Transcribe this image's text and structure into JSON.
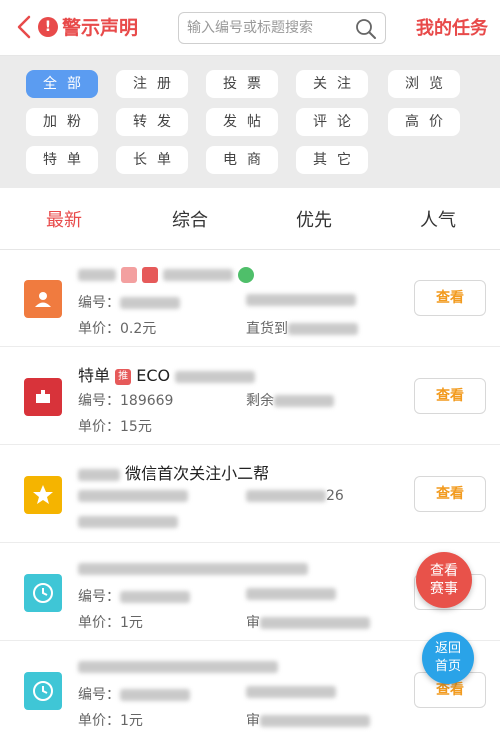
{
  "header": {
    "title": "警示声明",
    "search_placeholder": "输入编号或标题搜索",
    "my_tasks": "我的任务"
  },
  "categories": {
    "row1": [
      "全部",
      "注册",
      "投票",
      "关注",
      "浏览"
    ],
    "row2": [
      "加粉",
      "转发",
      "发帖",
      "评论",
      "高价"
    ],
    "row3": [
      "特单",
      "长单",
      "电商",
      "其它"
    ],
    "active": "全部"
  },
  "tabs": [
    "最新",
    "综合",
    "优先",
    "人气"
  ],
  "list": {
    "view_label": "查看",
    "items": [
      {
        "title_prefix": "",
        "title_suffix": "",
        "line1_left": "编号：",
        "line1_right": "",
        "line2_left": "单价：0.2元",
        "line2_right": "直货到"
      },
      {
        "title_prefix": "特单",
        "title_suffix": "ECO",
        "tag": "推",
        "line1_left": "编号：189669",
        "line1_right": "剩余",
        "line2_left": "单价：15元",
        "line2_right": ""
      },
      {
        "title_prefix": "",
        "title_suffix": "微信首次关注小二帮",
        "line1_left": "",
        "line1_right": "26",
        "line2_left": "",
        "line2_right": ""
      },
      {
        "title_prefix": "",
        "title_suffix": "",
        "line1_left": "编号：",
        "line1_right": "",
        "line2_left": "单价：1元",
        "line2_right": "审"
      },
      {
        "title_prefix": "",
        "title_suffix": "",
        "line1_left": "编号：",
        "line1_right": "",
        "line2_left": "单价：1元",
        "line2_right": "审"
      }
    ]
  },
  "fab": {
    "contest": "查看赛事",
    "home": "返回首页"
  },
  "colors": {
    "accent_red": "#e84a4a",
    "active_blue": "#5b9cf1",
    "view_orange": "#f29b1f",
    "fab_blue": "#2aa3e8"
  }
}
